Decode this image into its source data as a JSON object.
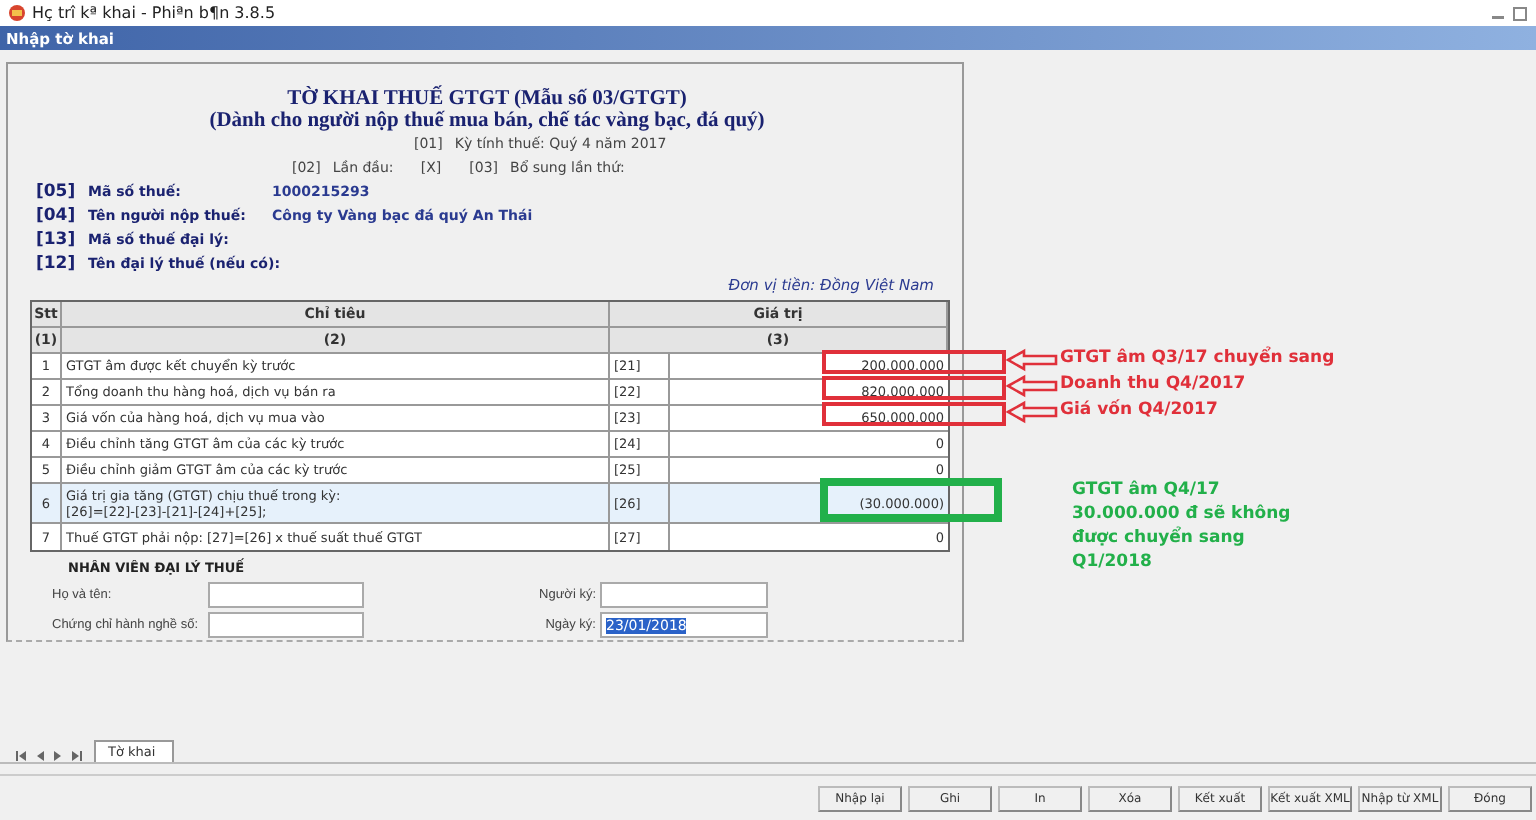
{
  "window": {
    "title": "Hç trî kª khai - Phiªn b¶n 3.8.5"
  },
  "panel_title": "Nhập tờ khai",
  "form": {
    "title": "TỜ KHAI THUẾ GTGT (Mẫu số 03/GTGT)",
    "subtitle": "(Dành cho người nộp thuế mua bán, chế tác vàng bạc, đá quý)",
    "period": {
      "code": "[01]",
      "label": "Kỳ tính thuế: Quý 4 năm 2017"
    },
    "first_time": {
      "code": "[02]",
      "label": "Lần đầu:",
      "mark": "[X]"
    },
    "supplement": {
      "code": "[03]",
      "label": "Bổ sung lần thứ:"
    },
    "fields": [
      {
        "code": "[05]",
        "label": "Mã số thuế:",
        "value": "1000215293"
      },
      {
        "code": "[04]",
        "label": "Tên người nộp thuế:",
        "value": "Công ty Vàng bạc đá quý An Thái"
      },
      {
        "code": "[13]",
        "label": "Mã số thuế đại lý:"
      },
      {
        "code": "[12]",
        "label": "Tên đại lý thuế (nếu có):"
      }
    ],
    "currency": "Đơn vị tiền: Đồng Việt Nam"
  },
  "table": {
    "columns": [
      "Stt",
      "Chỉ tiêu",
      "Giá trị"
    ],
    "column_numbers": [
      "(1)",
      "(2)",
      "(3)"
    ],
    "rows": [
      {
        "stt": "1",
        "label": "GTGT âm được kết chuyển kỳ trước",
        "code": "[21]",
        "value": "200.000.000",
        "selected": false,
        "note": {
          "kind": "arrow",
          "color": "#e0303a",
          "text": "GTGT âm Q3/17 chuyển sang"
        }
      },
      {
        "stt": "2",
        "label": "Tổng doanh thu hàng hoá, dịch vụ bán ra",
        "code": "[22]",
        "value": "820.000.000",
        "selected": false,
        "note": {
          "kind": "arrow",
          "color": "#e0303a",
          "text": "Doanh thu Q4/2017"
        }
      },
      {
        "stt": "3",
        "label": "Giá vốn của hàng hoá, dịch vụ mua vào",
        "code": "[23]",
        "value": "650.000.000",
        "selected": false,
        "note": {
          "kind": "arrow",
          "color": "#e0303a",
          "text": "Giá vốn Q4/2017"
        }
      },
      {
        "stt": "4",
        "label": "Điều chỉnh tăng GTGT âm của các kỳ trước",
        "code": "[24]",
        "value": "0",
        "selected": false
      },
      {
        "stt": "5",
        "label": "Điều chỉnh giảm GTGT âm của các kỳ trước",
        "code": "[25]",
        "value": "0",
        "selected": false
      },
      {
        "stt": "6",
        "label": "Giá trị gia tăng (GTGT) chịu thuế trong kỳ:",
        "formula": "[26]=[22]-[23]-[21]-[24]+[25];",
        "code": "[26]",
        "value": "(30.000.000)",
        "selected": true,
        "note": {
          "kind": "box",
          "color": "#22b04a",
          "lines": [
            "GTGT âm Q4/17",
            "30.000.000 đ sẽ không",
            "được chuyển sang",
            "Q1/2018"
          ]
        }
      },
      {
        "stt": "7",
        "label": "Thuế GTGT phải nộp: [27]=[26] x thuế suất thuế GTGT",
        "code": "[27]",
        "value": "0",
        "selected": false
      }
    ]
  },
  "agent": {
    "title": "NHÂN VIÊN ĐẠI LÝ THUẾ",
    "left_fields": [
      {
        "label": "Họ và tên:"
      },
      {
        "label": "Chứng chỉ hành nghề số:"
      }
    ],
    "right_fields": [
      {
        "label": "Người ký:"
      },
      {
        "label": "Ngày ký:",
        "value": "23/01/2018"
      }
    ]
  },
  "sheet_tabs": [
    {
      "label": "Tờ khai",
      "selected": true
    }
  ],
  "buttons": [
    "Nhập lại",
    "Ghi",
    "In",
    "Xóa",
    "Kết xuất",
    "Kết xuất XML",
    "Nhập từ XML",
    "Đóng"
  ]
}
